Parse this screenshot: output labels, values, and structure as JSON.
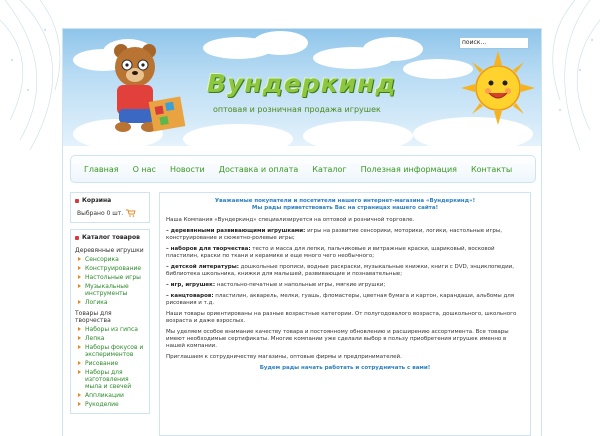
{
  "header": {
    "search_label": "поиск...",
    "logo_text": "Вундеркинд",
    "tagline": "оптовая и розничная продажа игрушек"
  },
  "nav": {
    "items": [
      "Главная",
      "О нас",
      "Новости",
      "Доставка и оплата",
      "Каталог",
      "Полезная информация",
      "Контакты"
    ]
  },
  "cart": {
    "title": "Корзина",
    "summary": "Выбрано 0 шт."
  },
  "catalog": {
    "title": "Каталог товаров",
    "groups": [
      {
        "name": "Деревянные игрушки",
        "items": [
          "Сенсорика",
          "Конструирование",
          "Настольные игры",
          "Музыкальные инструменты",
          "Логика"
        ]
      },
      {
        "name": "Товары для творчества",
        "items": [
          "Наборы из гипса",
          "Лепка",
          "Наборы фокусов и экспериментов",
          "Рисование",
          "Наборы для изготовления мыла и свечей",
          "Аппликации",
          "Рукоделие"
        ]
      }
    ]
  },
  "content": {
    "welcome_line1": "Уважаемые покупатели и посетители нашего интернет-магазина «Вундеркинд»!",
    "welcome_line2": "Мы рады приветствовать Вас на страницах нашего сайта!",
    "intro": "Наша Компания «Вундеркинд» специализируется на оптовой и розничной торговле.",
    "list": [
      {
        "lead": "– деревянными развивающими игрушками:",
        "text": " игры на развитие сенсорики, моторики, логики, настольные игры, конструирование и сюжетно-ролевые игры;"
      },
      {
        "lead": "– наборов для творчества:",
        "text": " тесто и масса для лепки, пальчиковые и витражные  краски, шариковый, восковой пластилин, краски по ткани и керамике и еще много чего необычного;"
      },
      {
        "lead": "– детской литературы:",
        "text": " дошкольные прописи, водные раскраски, музыкальные книжки, книги с DVD, энциклопедии, библиотека школьника, книжки для малышей, развивающие и познавательные;"
      },
      {
        "lead": "– игр, игрушек:",
        "text": " настольно-печатные и напольные игры, мягкие игрушки;"
      },
      {
        "lead": "– канцтоваров:",
        "text": " пластилин, акварель, мелки, гуашь, фломастеры, цветная бумага и картон, карандаши, альбомы для рисования и т.д."
      }
    ],
    "para_audience": "Наши товары ориентированы на разные возрастные категории. От полугодовалого возраста, дошкольного, школьного возраста и даже взрослых.",
    "para_quality": "Мы уделяем особое внимание качеству товара и постоянному обновлению и расширению ассортимента. Все товары имеют необходимые сертификаты. Многие компании  уже сделали выбор в пользу приобретения игрушек именно в нашей компании.",
    "para_invite": "Приглашаем к сотрудничеству магазины, оптовые фирмы и предпринимателей.",
    "closing": "Будем рады начать работать и сотрудничать с вами!"
  },
  "colors": {
    "accent_green": "#8dc63f",
    "link_green": "#2a8a2a",
    "accent_blue": "#2a7fc1",
    "frame_border": "#cfe4f2"
  }
}
